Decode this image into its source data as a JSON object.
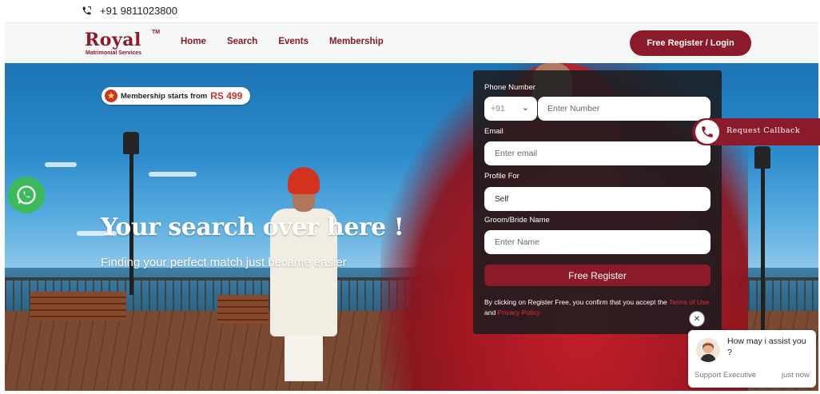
{
  "topbar": {
    "phone": "+91 9811023800"
  },
  "logo": {
    "brand": "Royal",
    "tm": "TM",
    "subtitle": "Matrimonial Services"
  },
  "nav": {
    "items": [
      {
        "label": "Home"
      },
      {
        "label": "Search"
      },
      {
        "label": "Events"
      },
      {
        "label": "Membership"
      }
    ],
    "cta": "Free Register / Login"
  },
  "hero": {
    "badge_text": "Membership starts from",
    "badge_price": "RS 499",
    "title": "Your search over here !",
    "subtitle": "Finding your perfect match just became easier"
  },
  "form": {
    "phone_label": "Phone Number",
    "country_code": "+91",
    "phone_placeholder": "Enter Number",
    "email_label": "Email",
    "email_placeholder": "Enter email",
    "profile_label": "Profile For",
    "profile_value": "Self",
    "name_label": "Groom/Bride Name",
    "name_placeholder": "Enter Name",
    "submit": "Free Register",
    "terms_prefix": "By clicking on Register Free, you confirm that you accept the",
    "terms_link": "Terms of Use",
    "terms_and": "and",
    "privacy_link": "Privacy Policy"
  },
  "callback": {
    "label": "Request Callback"
  },
  "chat": {
    "message": "How may i assist you ?",
    "agent": "Support Executive",
    "time": "just now"
  },
  "icons": {
    "phone": "phone-icon",
    "whatsapp": "whatsapp-icon",
    "star": "star-icon",
    "chevron": "chevron-down-icon",
    "callback": "phone-call-icon",
    "close": "close-icon"
  },
  "colors": {
    "brand": "#8b1a2b",
    "whatsapp": "#3cb95a",
    "price": "#c0392b",
    "link": "#e0303a"
  }
}
